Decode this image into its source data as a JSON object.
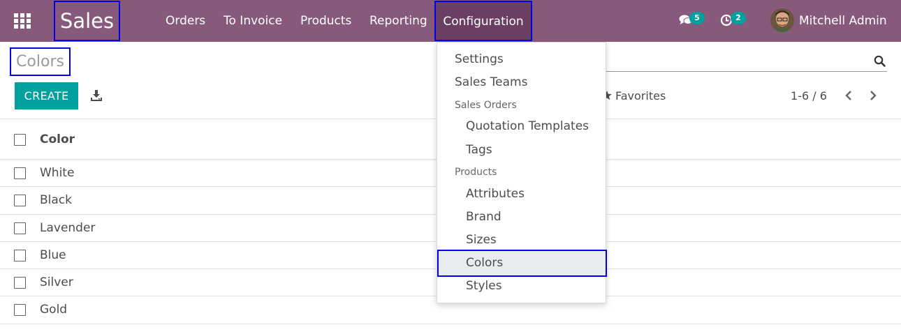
{
  "navbar": {
    "app_name": "Sales",
    "menus": {
      "orders": "Orders",
      "to_invoice": "To Invoice",
      "products": "Products",
      "reporting": "Reporting",
      "configuration": "Configuration"
    },
    "messages_count": "5",
    "activities_count": "2",
    "user_name": "Mitchell Admin"
  },
  "page": {
    "title": "Colors",
    "create_label": "CREATE",
    "favorites_label": "Favorites",
    "pager": "1-6 / 6"
  },
  "dropdown": {
    "settings": "Settings",
    "sales_teams": "Sales Teams",
    "sales_orders_header": "Sales Orders",
    "quotation_templates": "Quotation Templates",
    "tags": "Tags",
    "products_header": "Products",
    "attributes": "Attributes",
    "brand": "Brand",
    "sizes": "Sizes",
    "colors": "Colors",
    "styles": "Styles"
  },
  "list": {
    "column_header": "Color",
    "rows": [
      "White",
      "Black",
      "Lavender",
      "Blue",
      "Silver",
      "Gold"
    ]
  },
  "colors": {
    "navbar": "#875a7b",
    "navbar_active": "#6b3f63",
    "primary_button": "#00a09d",
    "badge": "#00a09d",
    "highlight_border": "#0000ee"
  }
}
